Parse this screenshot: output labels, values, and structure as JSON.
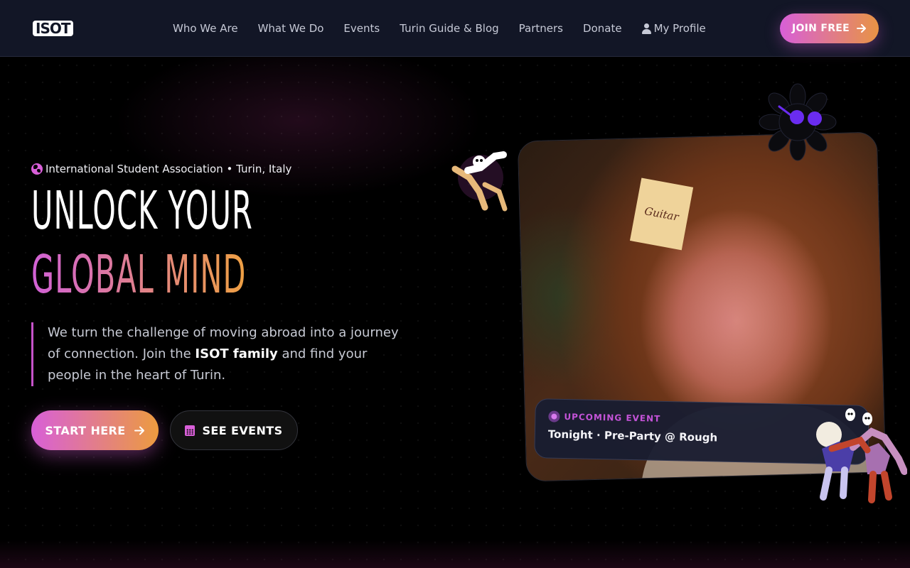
{
  "nav": {
    "logo": "ISOT",
    "links": [
      {
        "label": "Who We Are"
      },
      {
        "label": "What We Do"
      },
      {
        "label": "Events"
      },
      {
        "label": "Turin Guide & Blog"
      },
      {
        "label": "Partners"
      },
      {
        "label": "Donate"
      },
      {
        "label": "My Profile",
        "icon": "user-icon"
      }
    ],
    "cta_label": "JOIN FREE",
    "cta_icon": "arrow-right-icon"
  },
  "hero": {
    "eyebrow": "International Student Association • Turin, Italy",
    "eyebrow_icon": "globe-icon",
    "headline_line1": "Unlock Your",
    "headline_line2": "Global Mind",
    "lead_part1": "We turn the challenge of moving abroad into a journey of connection. Join the ",
    "lead_bold": "ISOT family",
    "lead_part2": " and find your people in the heart of Turin.",
    "primary_button": "START HERE",
    "secondary_button": "SEE EVENTS",
    "secondary_icon": "calendar-icon"
  },
  "photo": {
    "note_text": "Guitar"
  },
  "event_card": {
    "tag": "UPCOMING EVENT",
    "title": "Tonight · Pre-Party @ Rough"
  },
  "colors": {
    "accent_pink": "#d85fd8",
    "accent_orange": "#e89444",
    "nav_bg": "#121626",
    "page_bg": "#000000"
  }
}
